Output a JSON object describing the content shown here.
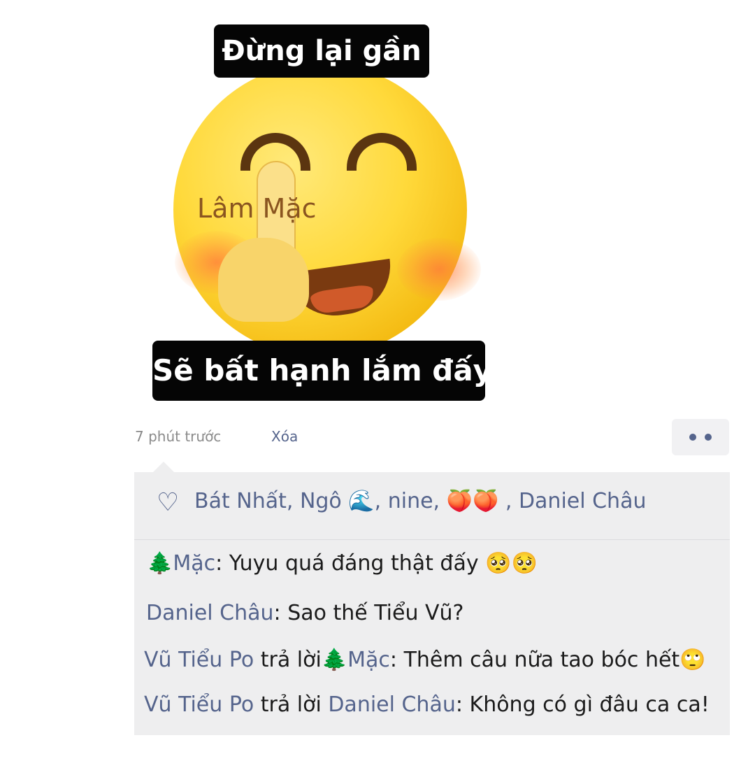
{
  "meme": {
    "caption_top": "Đừng lại gần",
    "caption_bottom": "Sẽ bất hạnh lắm đấy",
    "watermark": "Lâm Mặc",
    "face_icon": "smiling-face-shush-icon"
  },
  "post": {
    "time": "7 phút trước",
    "delete_label": "Xóa",
    "more_icon": "more-dots-icon"
  },
  "likes": {
    "icon": "heart-outline-icon",
    "text": "Bát Nhất, Ngô 🌊, nine, 🍑🍑 , Daniel Châu"
  },
  "comments": [
    {
      "name": "🌲Mặc",
      "sep": ": ",
      "text": "Yuyu quá đáng thật đấy 🥺🥺"
    },
    {
      "name": "Daniel Châu",
      "sep": ": ",
      "text": "Sao thế Tiểu Vũ?"
    },
    {
      "name": "Vũ Tiểu Po",
      "reply_word": " trả lời",
      "target": "🌲Mặc",
      "sep": ": ",
      "text": "Thêm câu nữa tao bóc hết🙄"
    },
    {
      "name": "Vũ Tiểu Po",
      "reply_word": " trả lời ",
      "target": "Daniel Châu",
      "sep": ": ",
      "text": "Không có gì đâu ca ca!"
    }
  ],
  "colors": {
    "link": "#55648c",
    "panel_bg": "#eeeeef",
    "caption_bg": "#050505"
  }
}
